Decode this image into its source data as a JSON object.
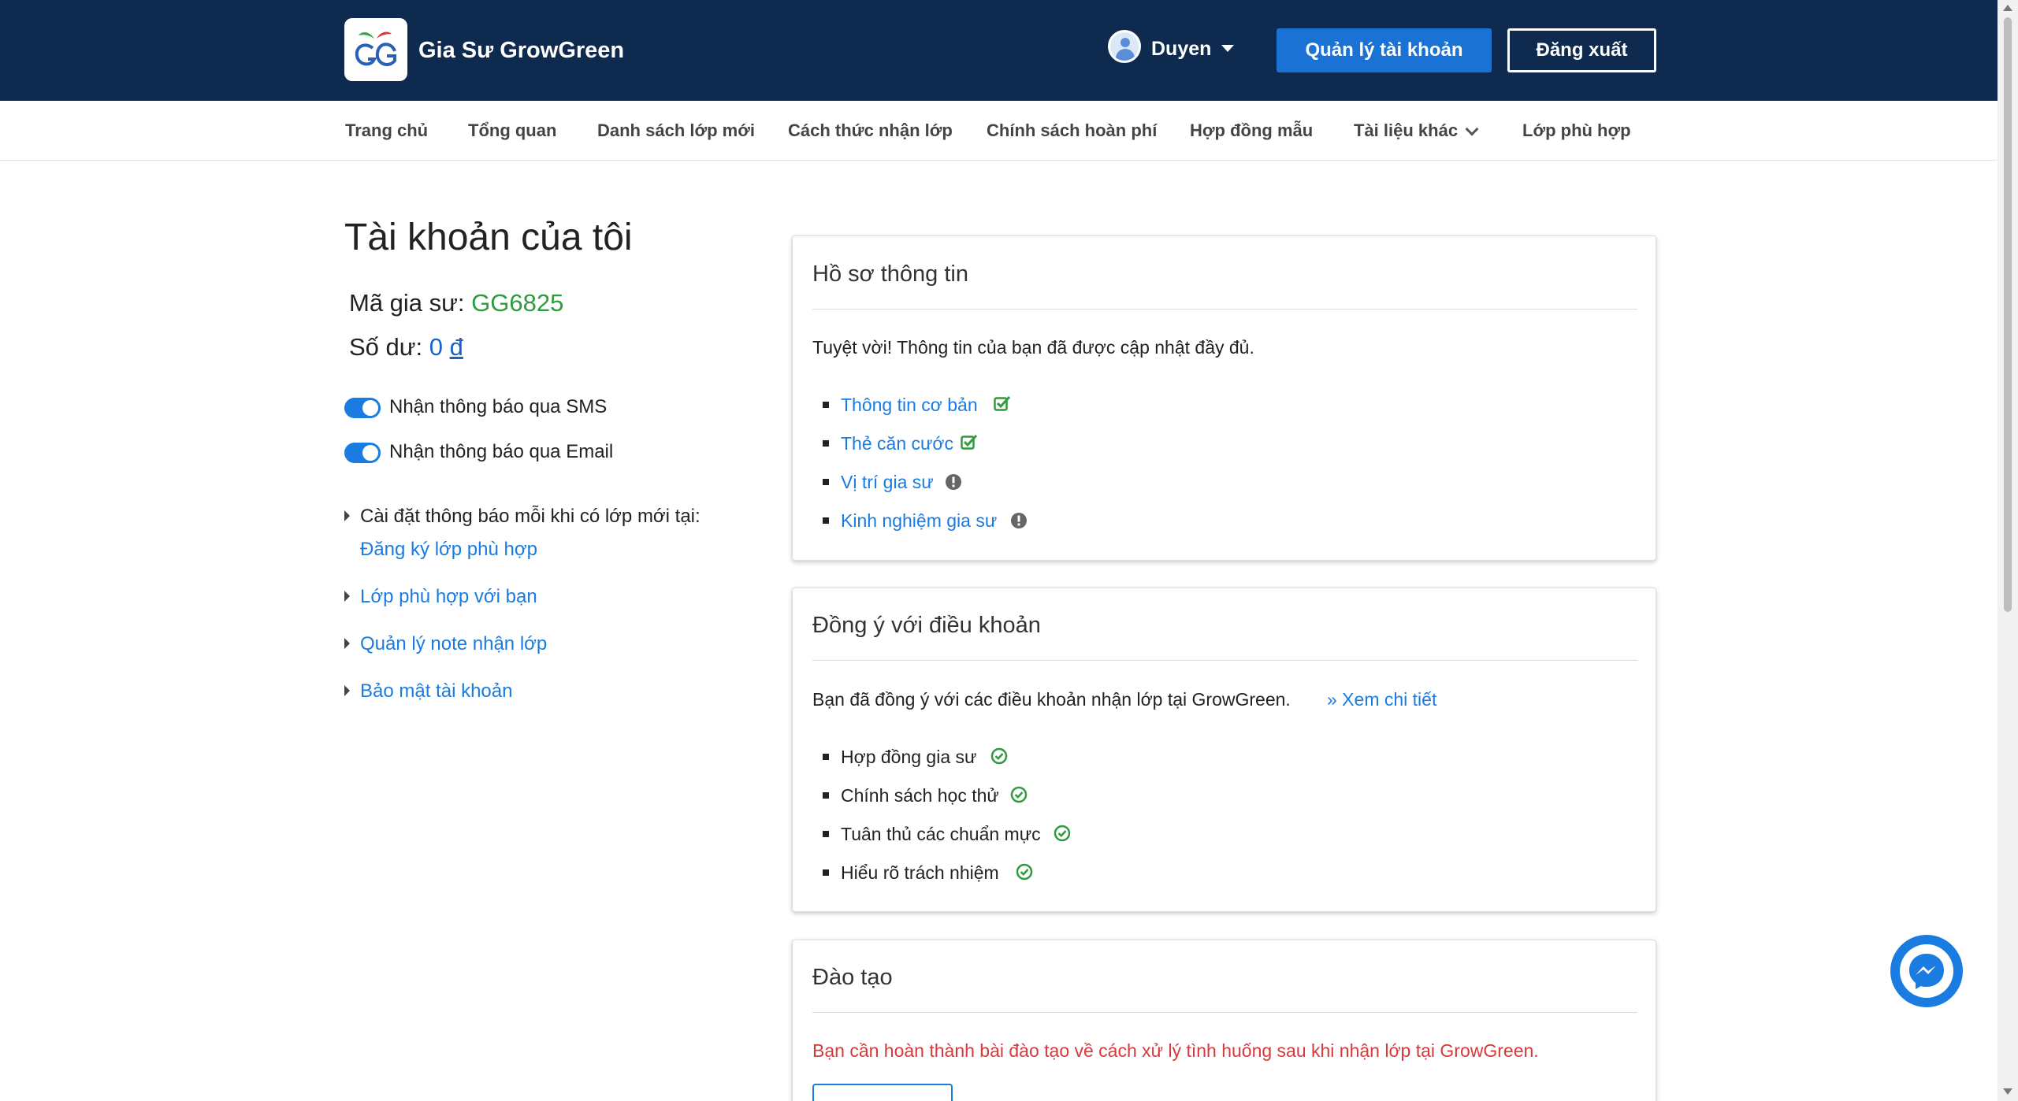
{
  "header": {
    "brand": "Gia Sư GrowGreen",
    "user_name": "Duyen",
    "account_button": "Quản lý tài khoản",
    "logout_button": "Đăng xuất",
    "colors": {
      "bar": "#0f2a4f",
      "primary": "#1a73d4"
    }
  },
  "nav": {
    "items": [
      "Trang chủ",
      "Tổng quan",
      "Danh sách lớp mới",
      "Cách thức nhận lớp",
      "Chính sách hoàn phí",
      "Hợp đồng mẫu",
      "Tài liệu khác",
      "Lớp phù hợp"
    ]
  },
  "account": {
    "title": "Tài khoản của tôi",
    "code_label": "Mã gia sư:",
    "code_value": "GG6825",
    "balance_label": "Số dư:",
    "balance_value": "0",
    "balance_currency": "đ",
    "sms_toggle_label": "Nhận thông báo qua SMS",
    "email_toggle_label": "Nhận thông báo qua Email",
    "sms_enabled": true,
    "email_enabled": true,
    "notify_setting_text": "Cài đặt thông báo mỗi khi có lớp mới tại:",
    "notify_setting_link": "Đăng ký lớp phù hợp",
    "links": [
      "Lớp phù hợp với bạn",
      "Quản lý note nhận lớp",
      "Bảo mật tài khoản"
    ]
  },
  "profile_card": {
    "title": "Hồ sơ thông tin",
    "message": "Tuyệt vời! Thông tin của bạn đã được cập nhật đầy đủ.",
    "items": [
      {
        "label": "Thông tin cơ bản",
        "icon": "check-square-icon"
      },
      {
        "label": "Thẻ căn cước",
        "icon": "check-square-icon"
      },
      {
        "label": "Vị trí gia sư",
        "icon": "exclamation-circle-icon"
      },
      {
        "label": "Kinh nghiệm gia sư",
        "icon": "exclamation-circle-icon"
      }
    ]
  },
  "terms_card": {
    "title": "Đồng ý với điều khoản",
    "message": "Bạn đã đồng ý với các điều khoản nhận lớp tại GrowGreen.",
    "detail_link": "» Xem chi tiết",
    "items": [
      "Hợp đồng gia sư",
      "Chính sách học thử",
      "Tuân thủ các chuẩn mực",
      "Hiểu rõ trách nhiệm"
    ]
  },
  "training_card": {
    "title": "Đào tạo",
    "message": "Bạn cần hoàn thành bài đào tạo về cách xử lý tình huống sau khi nhận lớp tại GrowGreen."
  }
}
